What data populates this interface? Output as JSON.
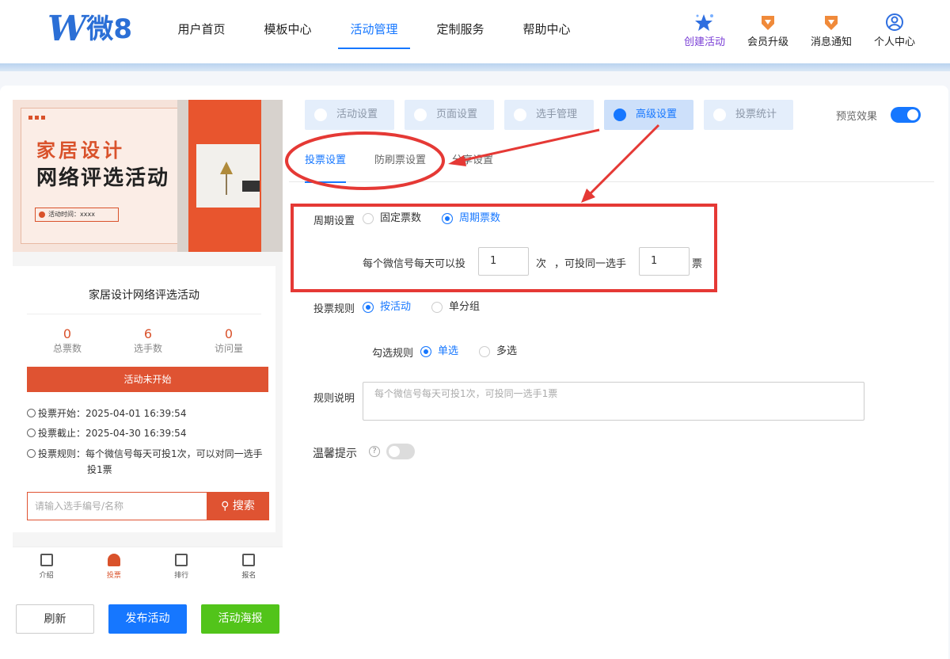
{
  "header": {
    "logo_text": "微8",
    "nav": [
      "用户首页",
      "模板中心",
      "活动管理",
      "定制服务",
      "帮助中心"
    ],
    "nav_active_index": 2,
    "actions": [
      {
        "label": "创建活动",
        "icon": "star-icon"
      },
      {
        "label": "会员升级",
        "icon": "diamond-badge-icon"
      },
      {
        "label": "消息通知",
        "icon": "diamond-badge-icon"
      },
      {
        "label": "个人中心",
        "icon": "user-circle-icon"
      }
    ]
  },
  "preview": {
    "banner": {
      "title_line1": "家居设计",
      "title_line2": "网络评选活动",
      "time_label": "活动时间：xxxx"
    },
    "activity_title": "家居设计网络评选活动",
    "stats": [
      {
        "value": "0",
        "label": "总票数"
      },
      {
        "value": "6",
        "label": "选手数"
      },
      {
        "value": "0",
        "label": "访问量"
      }
    ],
    "status": "活动未开始",
    "vote_start": "投票开始：2025-04-01 16:39:54",
    "vote_end": "投票截止：2025-04-30 16:39:54",
    "vote_rule_line1": "投票规则：每个微信号每天可投1次，可以对同一选手",
    "vote_rule_line2": "投1票",
    "search_placeholder": "请输入选手编号/名称",
    "search_button": "搜索",
    "tabs": [
      "介绍",
      "投票",
      "排行",
      "报名"
    ],
    "tabs_active_index": 1
  },
  "buttons": {
    "refresh": "刷新",
    "publish": "发布活动",
    "poster": "活动海报"
  },
  "steps": [
    "活动设置",
    "页面设置",
    "选手管理",
    "高级设置",
    "投票统计"
  ],
  "steps_active_index": 3,
  "preview_toggle_label": "预览效果",
  "preview_toggle_on": true,
  "sub_tabs": [
    "投票设置",
    "防刷票设置",
    "分享设置"
  ],
  "sub_tabs_active_index": 0,
  "form": {
    "period_label": "周期设置",
    "period_options": [
      "固定票数",
      "周期票数"
    ],
    "period_selected": "周期票数",
    "daily_prefix": "每个微信号每天可以投",
    "daily_value": "1",
    "daily_unit": "次",
    "same_player_prefix": "，可投同一选手",
    "same_player_value": "1",
    "same_player_unit": "票",
    "rule_label": "投票规则",
    "rule_options": [
      "按活动",
      "单分组"
    ],
    "rule_selected": "按活动",
    "check_rule_label": "勾选规则",
    "check_rule_options": [
      "单选",
      "多选"
    ],
    "check_rule_selected": "单选",
    "desc_label": "规则说明",
    "desc_placeholder": "每个微信号每天可投1次，可投同一选手1票",
    "tip_label": "温馨提示",
    "tip_toggle_on": false
  },
  "colors": {
    "accent": "#1677ff",
    "brand_red": "#df5332",
    "green": "#52c41a",
    "annotation": "#e53935"
  }
}
